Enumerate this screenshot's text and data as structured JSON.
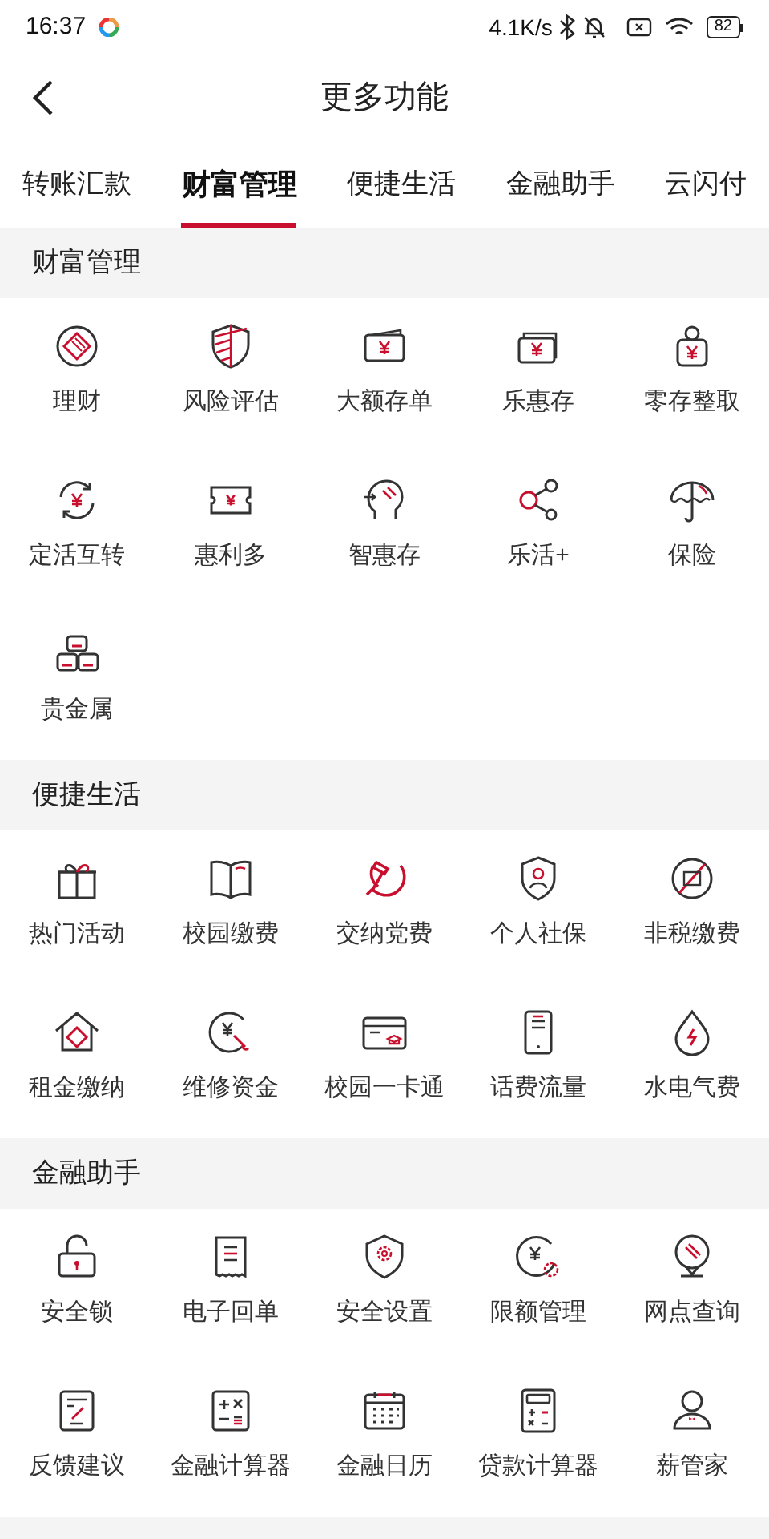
{
  "status_bar": {
    "time": "16:37",
    "speed": "4.1K/s",
    "battery": "82"
  },
  "header": {
    "title": "更多功能"
  },
  "tabs": [
    {
      "label": "转账汇款",
      "selected": false
    },
    {
      "label": "财富管理",
      "selected": true
    },
    {
      "label": "便捷生活",
      "selected": false
    },
    {
      "label": "金融助手",
      "selected": false
    },
    {
      "label": "云闪付",
      "selected": false
    }
  ],
  "sections": [
    {
      "title": "财富管理",
      "items": [
        "理财",
        "风险评估",
        "大额存单",
        "乐惠存",
        "零存整取",
        "定活互转",
        "惠利多",
        "智惠存",
        "乐活+",
        "保险",
        "贵金属"
      ]
    },
    {
      "title": "便捷生活",
      "items": [
        "热门活动",
        "校园缴费",
        "交纳党费",
        "个人社保",
        "非税缴费",
        "租金缴纳",
        "维修资金",
        "校园一卡通",
        "话费流量",
        "水电气费"
      ]
    },
    {
      "title": "金融助手",
      "items": [
        "安全锁",
        "电子回单",
        "安全设置",
        "限额管理",
        "网点查询",
        "反馈建议",
        "金融计算器",
        "金融日历",
        "贷款计算器",
        "薪管家"
      ]
    }
  ]
}
